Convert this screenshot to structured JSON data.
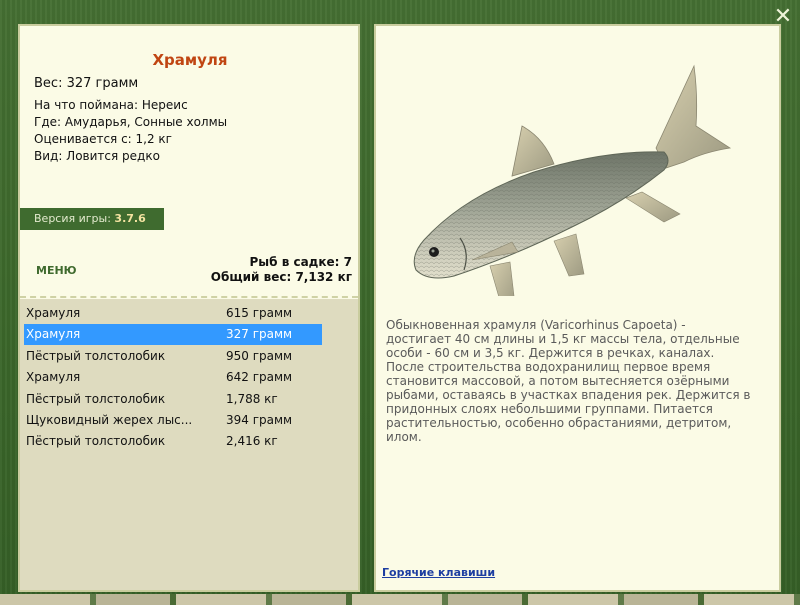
{
  "fish": {
    "title": "Храмуля",
    "weight_line": "Вес: 327 грамм",
    "caught_on": "На что поймана: Нереис",
    "location": "Где: Амударья, Сонные холмы",
    "value": "Оценивается с: 1,2 кг",
    "rarity": "Вид: Ловится редко"
  },
  "version": {
    "label": "Версия игры:",
    "value": "3.7.6"
  },
  "menu_label": "МЕНЮ",
  "keep": {
    "count": "Рыб в садке: 7",
    "total_weight": "Общий вес: 7,132 кг"
  },
  "catch_list": [
    {
      "name": "Храмуля",
      "weight": "615 грамм",
      "selected": false
    },
    {
      "name": "Храмуля",
      "weight": "327 грамм",
      "selected": true
    },
    {
      "name": "Пёстрый толстолобик",
      "weight": "950 грамм",
      "selected": false
    },
    {
      "name": "Храмуля",
      "weight": "642 грамм",
      "selected": false
    },
    {
      "name": "Пёстрый толстолобик",
      "weight": "1,788 кг",
      "selected": false
    },
    {
      "name": "Щуковидный жерех лыс...",
      "weight": "394 грамм",
      "selected": false
    },
    {
      "name": "Пёстрый толстолобик",
      "weight": "2,416 кг",
      "selected": false
    }
  ],
  "description": "Обыкновенная храмуля (Varicorhinus Capoeta) - достигает 40 см длины и 1,5 кг массы тела, отдельные особи - 60 см и 3,5 кг. Держится в речках, каналах. После строительства водохранилищ первое время становится массовой, а потом вытесняется озёрными рыбами, оставаясь в участках впадения рек. Держится в придонных слоях небольшими группами. Питается растительностью, особенно обрастаниями, детритом, илом.",
  "hotkeys_label": "Горячие клавиши",
  "close_glyph": "✕",
  "colors": {
    "title": "#c04512",
    "selected_row": "#3399ff",
    "panel_bg": "#fbfbe6",
    "frame_green": "#3f6b2f",
    "list_bg": "#dedbbf",
    "link_blue": "#1d3ea1"
  }
}
